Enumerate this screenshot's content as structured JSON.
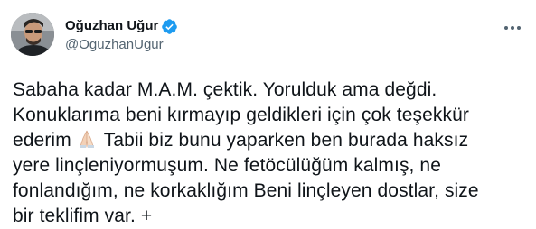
{
  "author": {
    "display_name": "Oğuzhan Uğur",
    "handle": "@OguzhanUgur",
    "verified": true,
    "avatar_icon": "profile-photo-icon"
  },
  "menu": {
    "icon": "more-options-icon"
  },
  "tweet": {
    "lines": [
      "Sabaha kadar M.A.M. çektik. Yorulduk ama değdi.",
      "Konuklarıma beni kırmayıp geldikleri için çok teşekkür",
      {
        "before": "ederim",
        "emoji": "folded-hands-emoji",
        "after": "Tabii biz bunu yaparken ben burada haksız"
      },
      "yere linçleniyormuşum. Ne fetöcülüğüm kalmış, ne",
      "fonlandığım, ne korkaklığım Beni linçleyen dostlar, size",
      "bir teklifim var. +"
    ]
  },
  "colors": {
    "text": "#0f1419",
    "secondary": "#536471",
    "verified": "#1d9bf0",
    "background": "#ffffff"
  }
}
